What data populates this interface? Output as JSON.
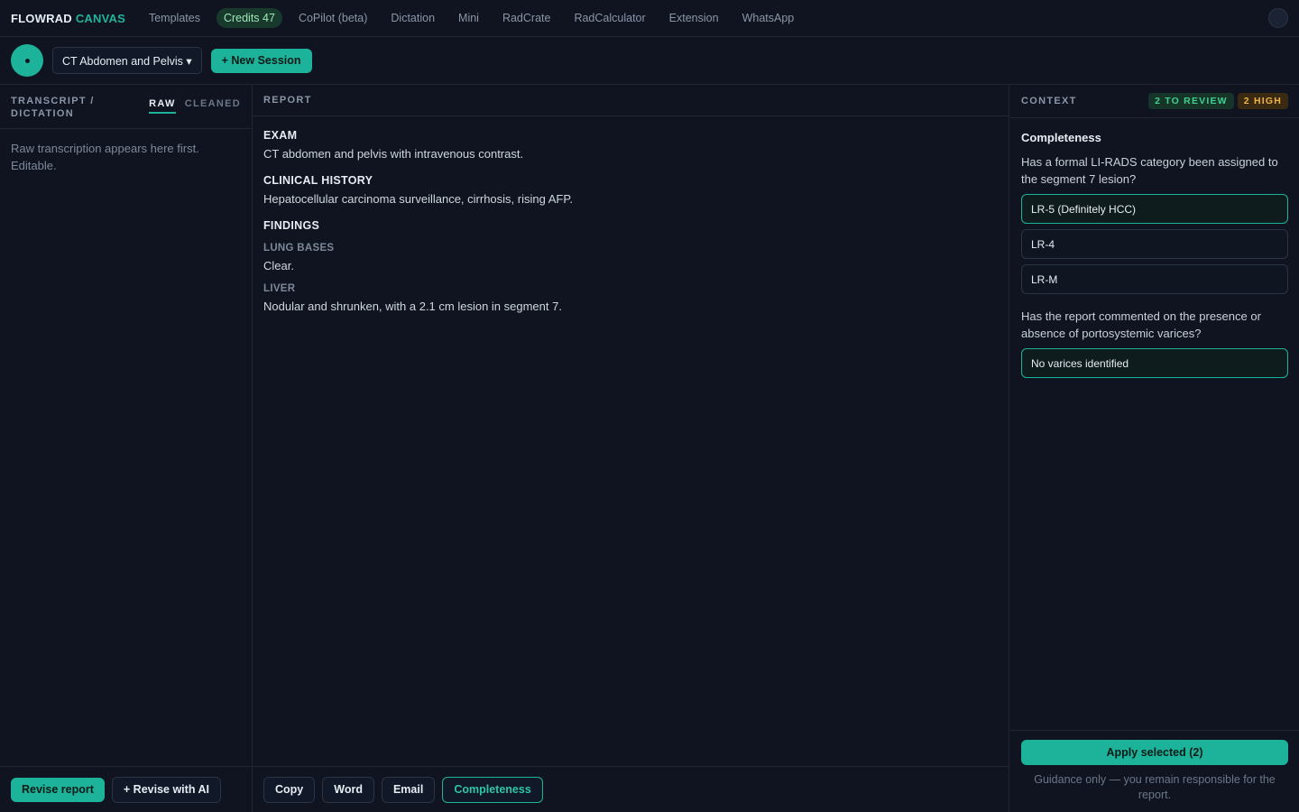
{
  "nav": {
    "brand_part1": "FLOWRAD",
    "brand_part2": "CANVAS",
    "links": [
      "Templates",
      "Credits 47",
      "CoPilot (beta)",
      "Dictation",
      "Mini",
      "RadCrate",
      "RadCalculator",
      "Extension",
      "WhatsApp"
    ]
  },
  "toolbar": {
    "template": "CT Abdomen and Pelvis ▾",
    "new_session": "+ New Session"
  },
  "transcript": {
    "title": "TRANSCRIPT / DICTATION",
    "tab_raw": "RAW",
    "tab_cleaned": "CLEANED",
    "placeholder": "Raw transcription appears here first. Editable.",
    "revise_report": "Revise report",
    "revise_ai": "+ Revise with AI"
  },
  "report": {
    "title": "REPORT",
    "exam_title": "EXAM",
    "exam_body": "CT abdomen and pelvis with intravenous contrast.",
    "history_title": "CLINICAL HISTORY",
    "history_body": "Hepatocellular carcinoma surveillance, cirrhosis, rising AFP.",
    "findings_title": "FINDINGS",
    "lung_title": "LUNG BASES",
    "lung_body": "Clear.",
    "liver_title": "LIVER",
    "liver_body": "Nodular and shrunken, with a 2.1 cm lesion in segment 7.",
    "actions": {
      "copy": "Copy",
      "word": "Word",
      "email": "Email",
      "completeness": "Completeness"
    }
  },
  "context": {
    "title": "CONTEXT",
    "badge_review": "2 TO REVIEW",
    "badge_high": "2 HIGH",
    "heading": "Completeness",
    "q1": "Has a formal LI-RADS category been assigned to the segment 7 lesion?",
    "q1_options": [
      "LR-5 (Definitely HCC)",
      "LR-4",
      "LR-M"
    ],
    "q2": "Has the report commented on the presence or absence of portosystemic varices?",
    "q2_options": [
      "No varices identified"
    ],
    "apply": "Apply selected (2)",
    "disclaimer": "Guidance only — you remain responsible for the report."
  },
  "colors": {
    "accent": "#1db39a",
    "background": "#0f1420",
    "high": "#f2b340"
  }
}
